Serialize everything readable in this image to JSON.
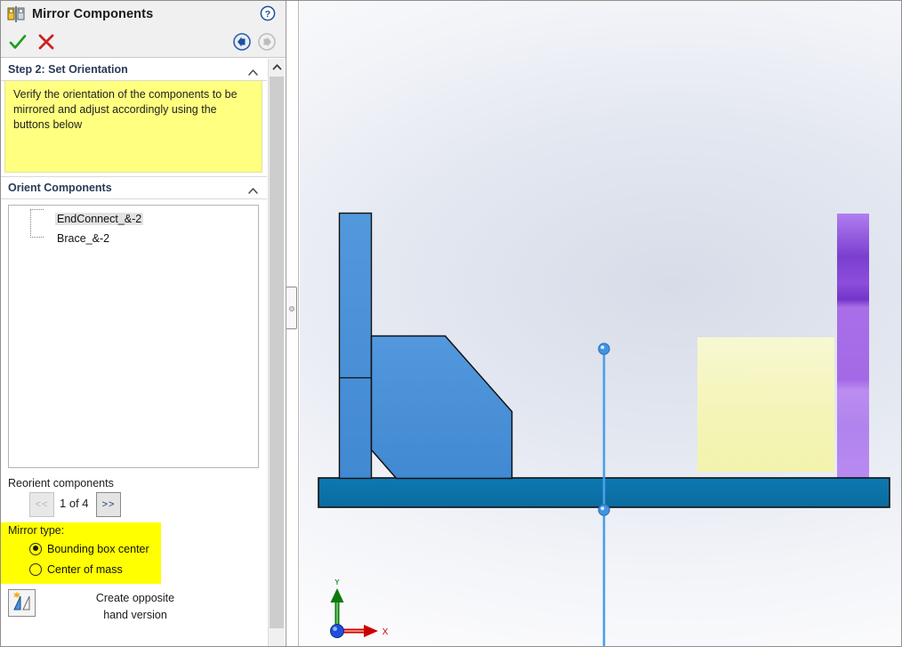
{
  "window": {
    "title": "Mirror Components",
    "title_icon": "mirror-components-icon",
    "help_icon": "help-icon"
  },
  "toolbar": {
    "ok_label": "OK",
    "ok_icon": "check-icon",
    "cancel_label": "Cancel",
    "cancel_icon": "x-icon",
    "back_label": "Back",
    "back_icon": "arrow-left-icon",
    "back_enabled": true,
    "forward_label": "Forward",
    "forward_icon": "arrow-right-icon",
    "forward_enabled": false
  },
  "step_section": {
    "title": "Step 2: Set Orientation",
    "collapse_icon": "chevron-up-icon",
    "instructions": "Verify the orientation of the components to be mirrored and adjust accordingly using the buttons below",
    "highlight_color": "#ffff80"
  },
  "orient_section": {
    "title": "Orient Components",
    "collapse_icon": "chevron-up-icon",
    "components": [
      {
        "name": "EndConnect_&-2",
        "selected": true
      },
      {
        "name": "Brace_&-2",
        "selected": false
      }
    ]
  },
  "reorient": {
    "label": "Reorient components",
    "prev_label": "<<",
    "prev_enabled": false,
    "next_label": ">>",
    "next_enabled": true,
    "page_text": "1 of 4"
  },
  "mirror_type": {
    "label": "Mirror type:",
    "highlight_color": "#ffff00",
    "options": [
      {
        "label": "Bounding box center",
        "selected": true
      },
      {
        "label": "Center of mass",
        "selected": false
      }
    ]
  },
  "opposite_hand": {
    "icon": "create-opposite-hand-icon",
    "line1": "Create opposite",
    "line2": "hand version"
  },
  "scrollbar": {
    "up_icon": "chevron-up-icon",
    "thumb": "scroll-thumb"
  },
  "splitter": {
    "handle_icon": "splitter-handle-dot"
  },
  "viewport": {
    "triad": {
      "x_label": "X",
      "y_label": "Y",
      "x_color": "#cc0000",
      "y_color": "#008000",
      "origin_color": "#1f4fd8"
    },
    "colors": {
      "body_blue": "#4a90d9",
      "base_blue": "#0d74ac",
      "mirror_line": "#4a9fe8",
      "preview_purple": "#a96ee8",
      "preview_yellow": "#f5f5b0",
      "edge": "#1a1a1a"
    },
    "mirror_plane_label": "mirror-plane-line"
  }
}
